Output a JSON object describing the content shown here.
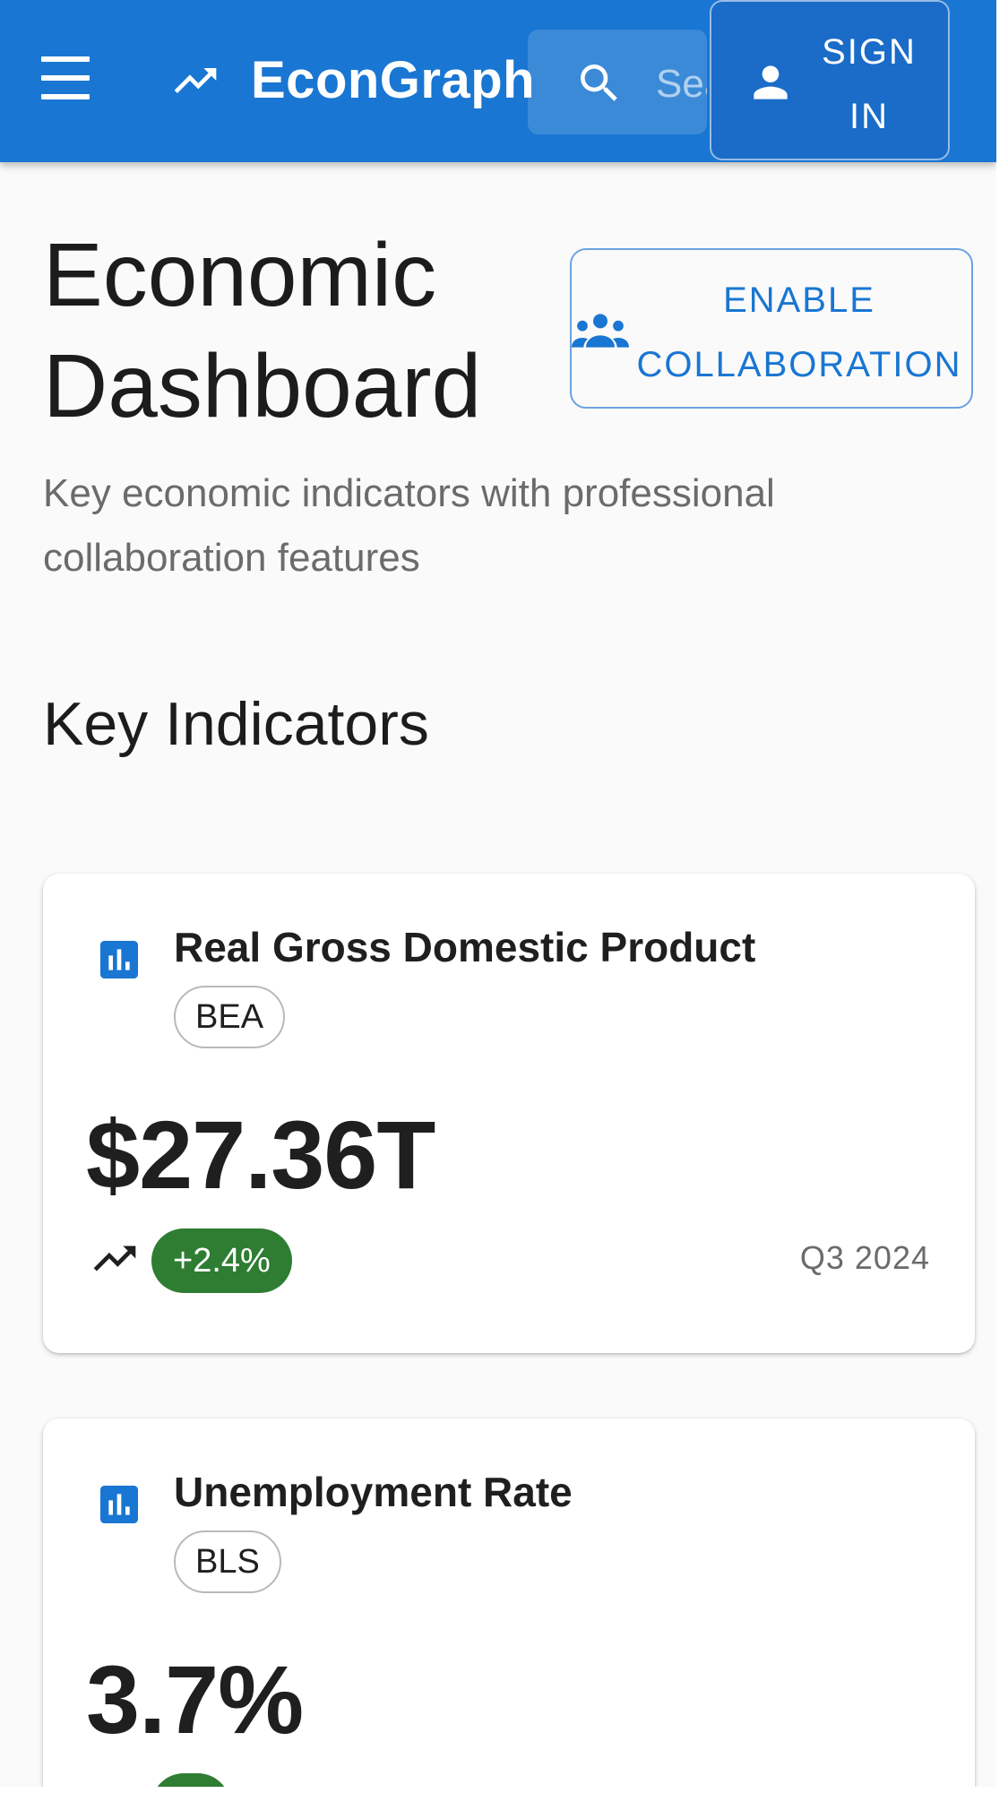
{
  "appbar": {
    "brand": "EconGraph",
    "search_placeholder": "Search",
    "signin_label": "SIGN\nIN"
  },
  "header": {
    "title": "Economic\nDashboard",
    "collab_label": "ENABLE\nCOLLABORATION",
    "subtitle": "Key economic indicators with professional\ncollaboration features"
  },
  "section": {
    "title": "Key Indicators"
  },
  "indicators": [
    {
      "title": "Real Gross Domestic Product",
      "source": "BEA",
      "value": "$27.36T",
      "change": "+2.4%",
      "period": "Q3 2024",
      "trend": "up"
    },
    {
      "title": "Unemployment Rate",
      "source": "BLS",
      "value": "3.7%",
      "trend": "up"
    }
  ],
  "colors": {
    "primary": "#1976d2",
    "positive": "#2e7d32",
    "background": "#fafafa"
  },
  "icons": [
    "menu-icon",
    "trending-up-icon",
    "search-icon",
    "person-icon",
    "group-icon",
    "bar-chart-icon"
  ]
}
